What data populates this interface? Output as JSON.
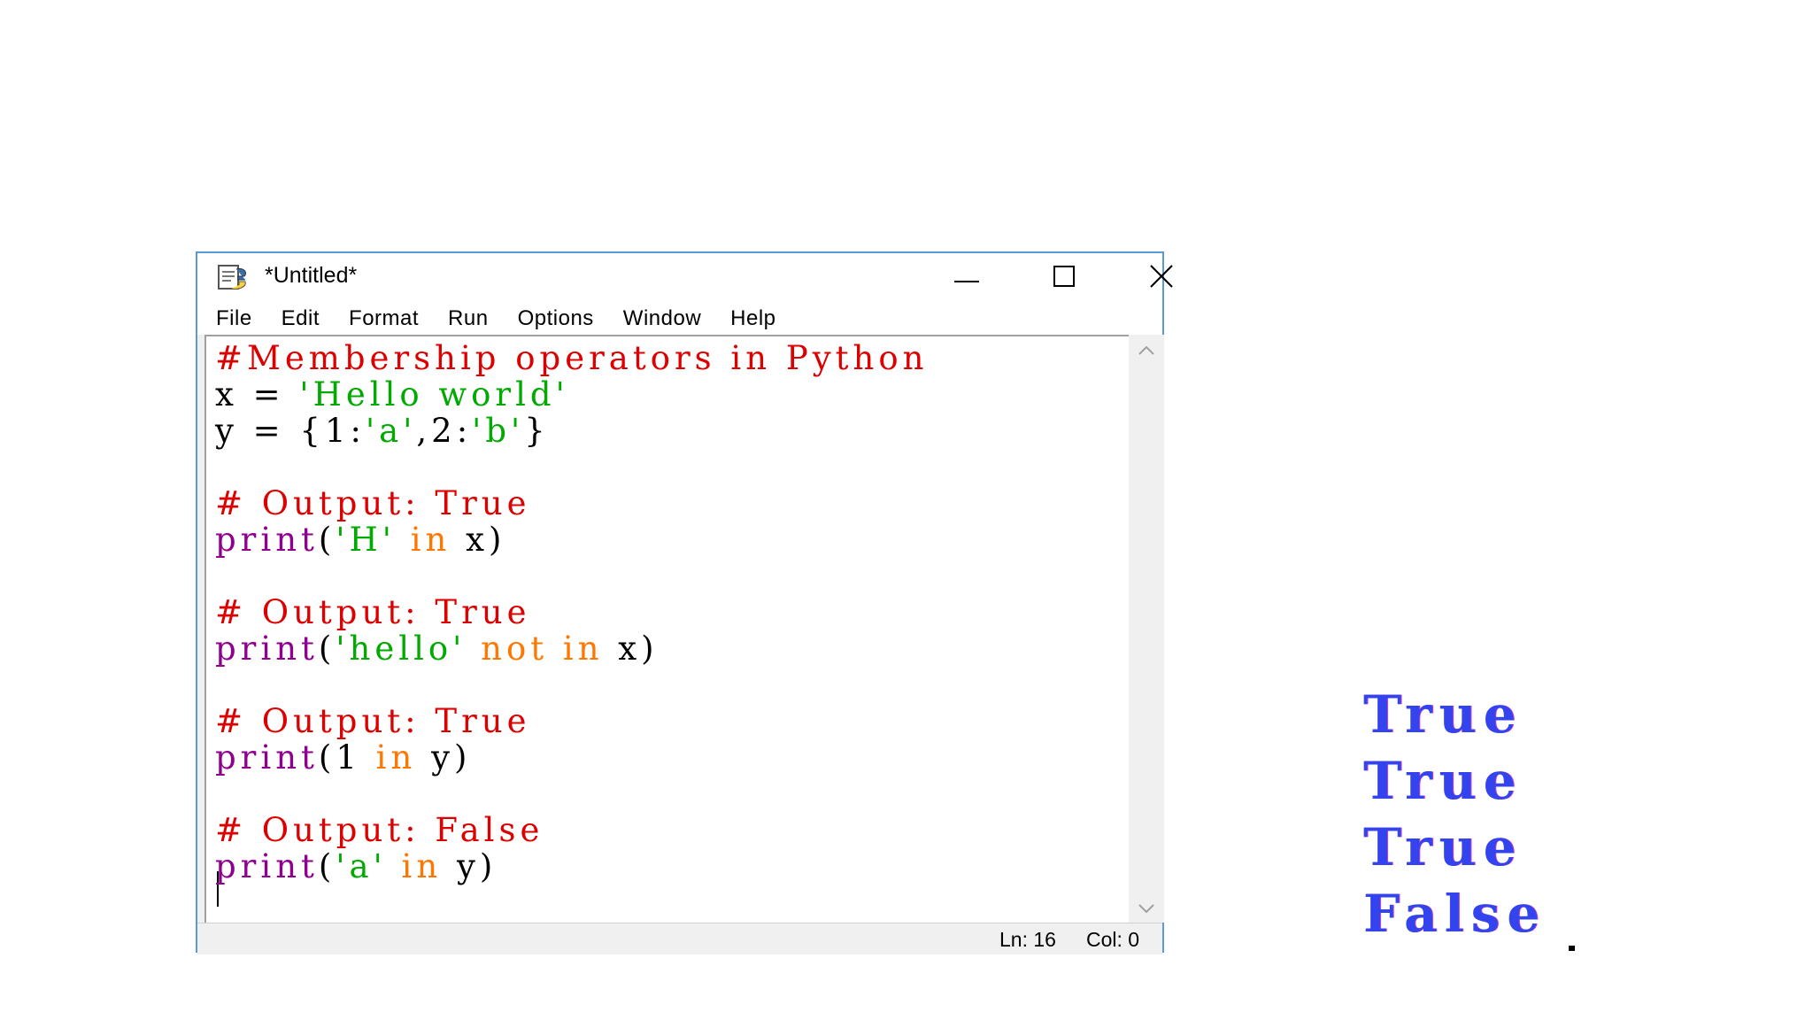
{
  "window": {
    "title": "*Untitled*",
    "icon": "idle-python-file-icon",
    "controls": [
      "minimize-icon",
      "maximize-icon",
      "close-icon"
    ]
  },
  "menu": {
    "items": [
      "File",
      "Edit",
      "Format",
      "Run",
      "Options",
      "Window",
      "Help"
    ]
  },
  "editor": {
    "lines": [
      [
        {
          "t": "#Membership operators in Python",
          "k": "comment"
        }
      ],
      [
        {
          "t": "x = ",
          "k": "plain"
        },
        {
          "t": "'Hello world'",
          "k": "string"
        }
      ],
      [
        {
          "t": "y = {1:",
          "k": "plain"
        },
        {
          "t": "'a'",
          "k": "string"
        },
        {
          "t": ",2:",
          "k": "plain"
        },
        {
          "t": "'b'",
          "k": "string"
        },
        {
          "t": "}",
          "k": "plain"
        }
      ],
      [],
      [
        {
          "t": "# Output: True",
          "k": "comment"
        }
      ],
      [
        {
          "t": "print",
          "k": "builtin"
        },
        {
          "t": "(",
          "k": "plain"
        },
        {
          "t": "'H'",
          "k": "string"
        },
        {
          "t": " ",
          "k": "plain"
        },
        {
          "t": "in",
          "k": "keyword"
        },
        {
          "t": " x)",
          "k": "plain"
        }
      ],
      [],
      [
        {
          "t": "# Output: True",
          "k": "comment"
        }
      ],
      [
        {
          "t": "print",
          "k": "builtin"
        },
        {
          "t": "(",
          "k": "plain"
        },
        {
          "t": "'hello'",
          "k": "string"
        },
        {
          "t": " ",
          "k": "plain"
        },
        {
          "t": "not",
          "k": "keyword"
        },
        {
          "t": " ",
          "k": "plain"
        },
        {
          "t": "in",
          "k": "keyword"
        },
        {
          "t": " x)",
          "k": "plain"
        }
      ],
      [],
      [
        {
          "t": "# Output: True",
          "k": "comment"
        }
      ],
      [
        {
          "t": "print",
          "k": "builtin"
        },
        {
          "t": "(1 ",
          "k": "plain"
        },
        {
          "t": "in",
          "k": "keyword"
        },
        {
          "t": " y)",
          "k": "plain"
        }
      ],
      [],
      [
        {
          "t": "# Output: False",
          "k": "comment"
        }
      ],
      [
        {
          "t": "print",
          "k": "builtin"
        },
        {
          "t": "(",
          "k": "plain"
        },
        {
          "t": "'a'",
          "k": "string"
        },
        {
          "t": " ",
          "k": "plain"
        },
        {
          "t": "in",
          "k": "keyword"
        },
        {
          "t": " y)",
          "k": "plain"
        }
      ]
    ],
    "syntax_colors": {
      "comment": "#dd0000",
      "string": "#00aa00",
      "builtin": "#900090",
      "keyword": "#ff7700",
      "plain": "#000000"
    }
  },
  "statusbar": {
    "line": "Ln: 16",
    "col": "Col: 0"
  },
  "output": {
    "lines": [
      "True",
      "True",
      "True",
      "False"
    ],
    "color": "#3344ee"
  }
}
